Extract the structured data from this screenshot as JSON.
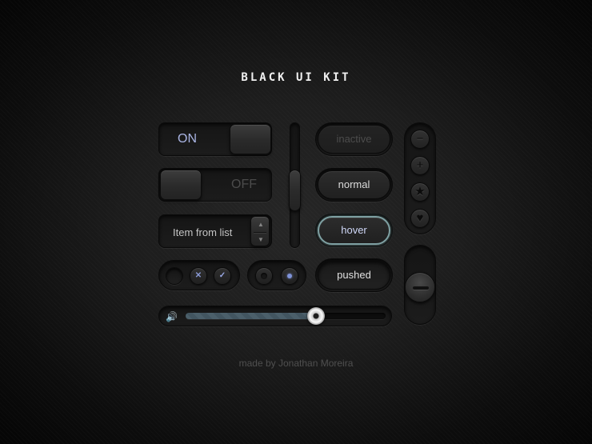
{
  "title": "BLACK UI KIT",
  "toggles": {
    "on_label": "ON",
    "off_label": "OFF"
  },
  "select": {
    "value": "Item from list",
    "up_glyph": "▲",
    "down_glyph": "▼"
  },
  "buttons": {
    "inactive": "inactive",
    "normal": "normal",
    "hover": "hover",
    "pushed": "pushed"
  },
  "icon_buttons": [
    {
      "icon": "minus-icon",
      "glyph": "−"
    },
    {
      "icon": "plus-icon",
      "glyph": "+"
    },
    {
      "icon": "star-icon",
      "glyph": "★"
    },
    {
      "icon": "heart-icon",
      "glyph": "♥"
    }
  ],
  "checkbox_group": [
    {
      "state": "empty",
      "glyph": ""
    },
    {
      "state": "x",
      "glyph": "✕"
    },
    {
      "state": "check",
      "glyph": "✓"
    }
  ],
  "radio_group": [
    {
      "state": "unselected"
    },
    {
      "state": "selected"
    }
  ],
  "volume": {
    "icon": "speaker-icon",
    "glyph": "🔊",
    "level": 0.65
  },
  "vertical_slider": {
    "level": 0.5
  },
  "footer": "made by Jonathan Moreira",
  "colors": {
    "accent_blue": "#7f93d8",
    "hover_border": "#7fa1a3",
    "on_label": "#a9b4e3",
    "off_label": "#4b4b4b"
  }
}
